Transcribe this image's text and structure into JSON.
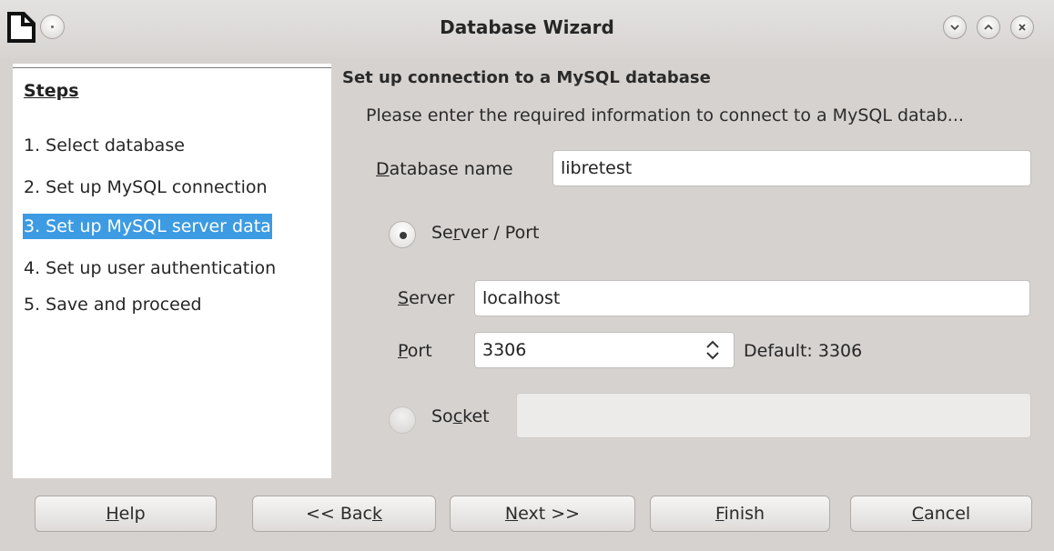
{
  "window": {
    "title": "Database Wizard"
  },
  "steps": {
    "heading": "Steps",
    "items": [
      {
        "label": "1. Select database"
      },
      {
        "label": "2. Set up MySQL connection"
      },
      {
        "label": "3. Set up MySQL server data",
        "active": true
      },
      {
        "label": "4. Set up user authentication"
      },
      {
        "label": "5. Save and proceed"
      }
    ]
  },
  "content": {
    "title": "Set up connection to a MySQL database",
    "description": "Please enter the required information to connect to a MySQL datab...",
    "database_name": {
      "label": "Database name",
      "value": "libretest"
    },
    "server_port_option": {
      "label": "Server / Port",
      "selected": true
    },
    "server": {
      "label": "Server",
      "value": "localhost"
    },
    "port": {
      "label": "Port",
      "value": "3306",
      "default_text": "Default: 3306"
    },
    "socket_option": {
      "label": "Socket",
      "selected": false,
      "value": ""
    }
  },
  "buttons": {
    "help": "Help",
    "back": "<< Back",
    "next": "Next >>",
    "finish": "Finish",
    "cancel": "Cancel"
  },
  "icons": {
    "app": "document-icon",
    "menu": "window-menu-icon",
    "minimize": "minimize-icon",
    "maximize": "maximize-icon",
    "close": "close-icon",
    "spin": "spin-updown-icon"
  },
  "colors": {
    "selection": "#3c9be2",
    "dialog_bg": "#d6d2d0"
  }
}
